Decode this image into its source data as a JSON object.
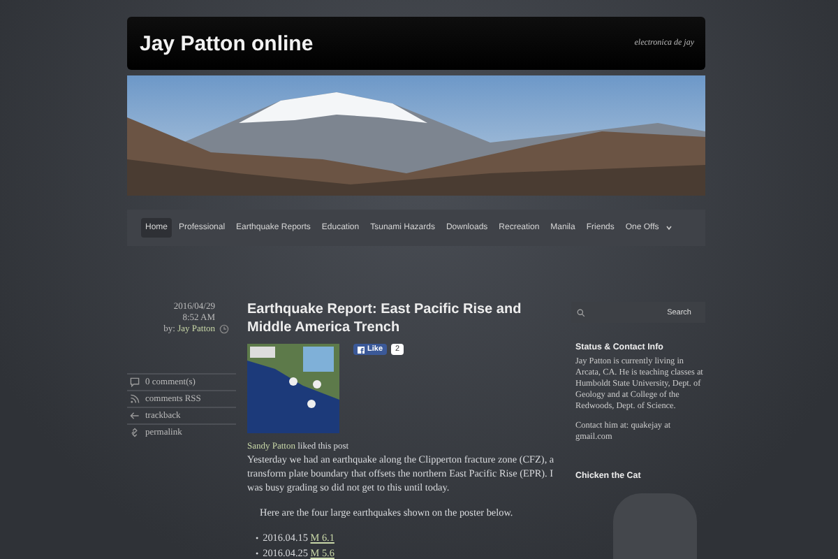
{
  "header": {
    "title": "Jay Patton online",
    "tagline": "electronica de jay"
  },
  "nav": [
    {
      "label": "Home",
      "selected": true
    },
    {
      "label": "Professional",
      "selected": false
    },
    {
      "label": "Earthquake Reports",
      "selected": false
    },
    {
      "label": "Education",
      "selected": false
    },
    {
      "label": "Tsunami Hazards",
      "selected": false
    },
    {
      "label": "Downloads",
      "selected": false
    },
    {
      "label": "Recreation",
      "selected": false
    },
    {
      "label": "Manila",
      "selected": false
    },
    {
      "label": "Friends",
      "selected": false
    },
    {
      "label": "One Offs",
      "selected": false
    }
  ],
  "post_meta": {
    "date": "2016/04/29",
    "time": "8:52 AM",
    "by_label": "by:",
    "author": "Jay Patton",
    "links": [
      {
        "kind": "comment",
        "label": "0 comment(s)"
      },
      {
        "kind": "rss",
        "label": "comments RSS"
      },
      {
        "kind": "trackback",
        "label": "trackback"
      },
      {
        "kind": "permalink",
        "label": "permalink"
      }
    ]
  },
  "post": {
    "title": "Earthquake Report: East Pacific Rise and Middle America Trench",
    "like_label": "Like",
    "like_count": "2",
    "liker": "Sandy Patton",
    "liked_text": "liked this post",
    "paragraph": "Yesterday we had an earthquake along the Clipperton fracture zone (CFZ), a transform plate boundary that offsets the northern East Pacific Rise (EPR). I was busy grading so did not get to this until today.",
    "intro": "Here are the four large earthquakes shown on the poster below.",
    "quakes": [
      {
        "bullet": "•",
        "date": "2016.04.15",
        "magnitude": "M 6.1"
      },
      {
        "bullet": "•",
        "date": "2016.04.25",
        "magnitude": "M 5.6"
      }
    ]
  },
  "sidebar": {
    "search_button": "Search",
    "widgets": [
      {
        "title": "Status & Contact Info",
        "paragraphs": [
          "Jay Patton is currently living in Arcata, CA. He is teaching classes at Humboldt State University, Dept. of Geology and at College of the Redwoods, Dept. of Science.",
          "Contact him at: quakejay at gmail.com"
        ]
      },
      {
        "title": "Chicken the Cat"
      }
    ]
  }
}
